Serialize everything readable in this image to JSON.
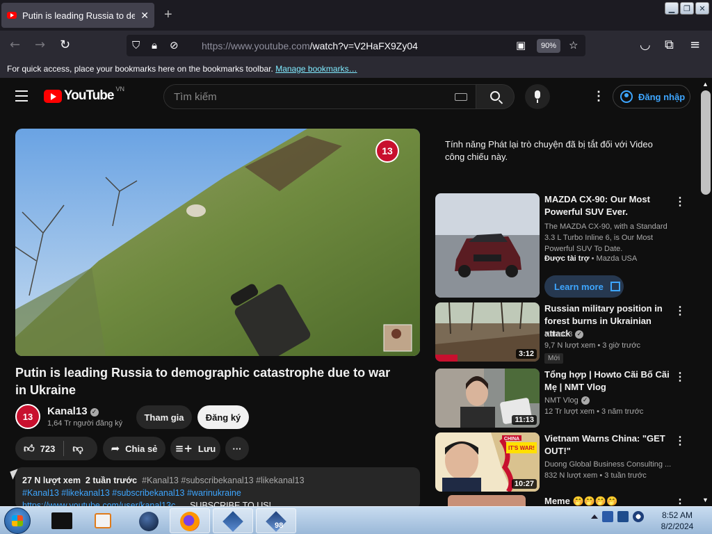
{
  "browser": {
    "tab_title": "Putin is leading Russia to demographic catastrophe due to war in Ukraine",
    "tab_close": "✕",
    "new_tab": "+",
    "url_host": "https://www.youtube.com",
    "url_path": "/watch?v=V2HaFX9Zy04",
    "zoom": "90%",
    "bookmarks_text": "For quick access, place your bookmarks here on the bookmarks toolbar.",
    "bookmarks_link": "Manage bookmarks…"
  },
  "youtube": {
    "logo_text": "YouTube",
    "region": "VN",
    "search_placeholder": "Tìm kiếm",
    "signin_label": "Đăng nhập"
  },
  "video": {
    "watermark": "13",
    "title": "Putin is leading Russia to demographic catastrophe due to war in Ukraine",
    "channel": "Kanal13",
    "channel_avatar": "13",
    "subscribers": "1,64 Tr người đăng ký",
    "join_label": "Tham gia",
    "subscribe_label": "Đăng ký",
    "likes": "723",
    "share_label": "Chia sẻ",
    "save_label": "Lưu",
    "more_label": "···",
    "views": "27 N lượt xem",
    "age": "2 tuần trước",
    "tags_line1": "#Kanal13 #subscribekanal13 #likekanal13",
    "tags_line2": "#Kanal13 #likekanal13 #subscribekanal13 #warinukraine",
    "desc_link": "https://www.youtube.com/user/kanal13c...",
    "desc_extra": "SUBSCRIBE TO US!"
  },
  "chat_note": "Tính năng Phát lại trò chuyện đã bị tắt đối với Video công chiếu này.",
  "recommendations": [
    {
      "title": "MAZDA CX-90: Our Most Powerful SUV Ever.",
      "description": "The MAZDA CX-90, with a Standard 3.3 L Turbo Inline 6, is Our Most Powerful SUV To Date.",
      "sponsored": "Được tài trợ",
      "advertiser": "Mazda USA",
      "cta": "Learn more"
    },
    {
      "title": "Russian military position in forest burns in Ukrainian attack",
      "channel": "Kanal13",
      "meta": "9,7 N lượt xem • 3 giờ trước",
      "badge": "Mới",
      "duration": "3:12"
    },
    {
      "title": "Tổng hợp | Howto Cãi Bố Cãi Mẹ | NMT Vlog",
      "channel": "NMT Vlog",
      "meta": "12 Tr lượt xem • 3 năm trước",
      "duration": "11:13"
    },
    {
      "title": "Vietnam Warns China: \"GET OUT!\"",
      "channel": "Duong Global Business Consulting ...",
      "meta": "832 N lượt xem • 3 tuần trước",
      "duration": "10:27",
      "thumb_text1": "CHINA",
      "thumb_text2": "IT'S WAR!"
    },
    {
      "title": "Meme 🤭🤭🤭🤭"
    }
  ],
  "taskbar": {
    "time": "8:52 AM",
    "date": "8/2/2024",
    "badge": "98"
  }
}
